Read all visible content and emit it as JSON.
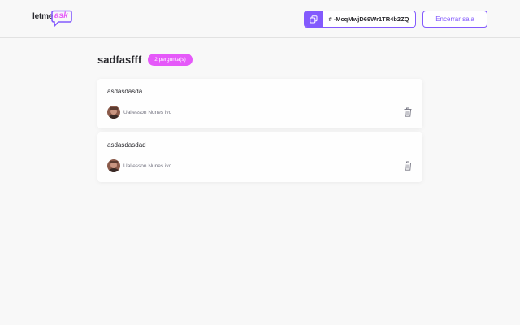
{
  "header": {
    "logo": {
      "text_main": "letme",
      "text_accent": "ask"
    },
    "room_code": {
      "label": "# -McqMwjD69Wr1TR4b2ZQ",
      "icon": "copy-icon"
    },
    "close_button": "Encerrar sala"
  },
  "room": {
    "title": "sadfasfff",
    "question_count": "2 pergunta(s)"
  },
  "questions": [
    {
      "content": "asdasdasda",
      "author": "Uallesson Nunes ivo",
      "action_icon": "trash-icon"
    },
    {
      "content": "asdasdasdad",
      "author": "Uallesson Nunes ivo",
      "action_icon": "trash-icon"
    }
  ],
  "colors": {
    "primary": "#835afd",
    "accent": "#e559f9",
    "background": "#f8f8f8"
  }
}
